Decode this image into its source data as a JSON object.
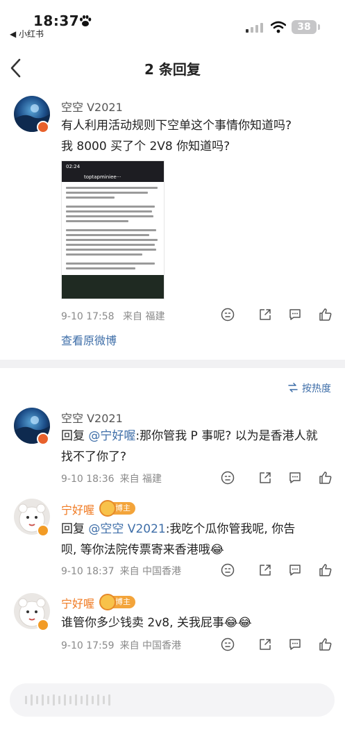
{
  "status_bar": {
    "time": "18:37",
    "back_app": "◀ 小红书",
    "battery": "38"
  },
  "header": {
    "title": "2 条回复"
  },
  "main_comment": {
    "username": "空空 V2021",
    "text_line1": "有人利用活动规则下空单这个事情你知道吗?",
    "text_line2": "我 8000 买了个 2V8 你知道吗?",
    "embed": {
      "time": "02:24",
      "user": "toptapminiee···"
    },
    "date": "9-10 17:58",
    "source": "来自 福建",
    "view_original": "查看原微博"
  },
  "sort": {
    "label": "按热度"
  },
  "replies": [
    {
      "username": "空空 V2021",
      "prefix": "回复 ",
      "mention": "@宁好喔",
      "text_line1_rest": ":那你管我 P 事呢? 以为是香港人就",
      "text_line2": "找不了你了?",
      "date": "9-10 18:36",
      "source": "来自 福建"
    },
    {
      "username": "宁好喔",
      "badge": "博主",
      "prefix": "回复 ",
      "mention": "@空空 V2021",
      "text_line1_rest": ":我吃个瓜你管我呢, 你告",
      "text_line2": "呗, 等你法院传票寄来香港哦😂",
      "date": "9-10 18:37",
      "source": "来自 中国香港"
    },
    {
      "username": "宁好喔",
      "badge": "博主",
      "text_line1": "谁管你多少钱卖 2v8, 关我屁事😂😂",
      "date": "9-10 17:59",
      "source": "来自 中国香港"
    }
  ],
  "colors": {
    "link": "#3e6ea8",
    "orange_name": "#f07a22",
    "meta_gray": "#8a8a8a"
  },
  "icons": [
    "paw-icon",
    "signal-icon",
    "wifi-icon",
    "back-chevron-icon",
    "emoji-icon",
    "share-icon",
    "comment-icon",
    "like-icon",
    "sort-icon"
  ]
}
